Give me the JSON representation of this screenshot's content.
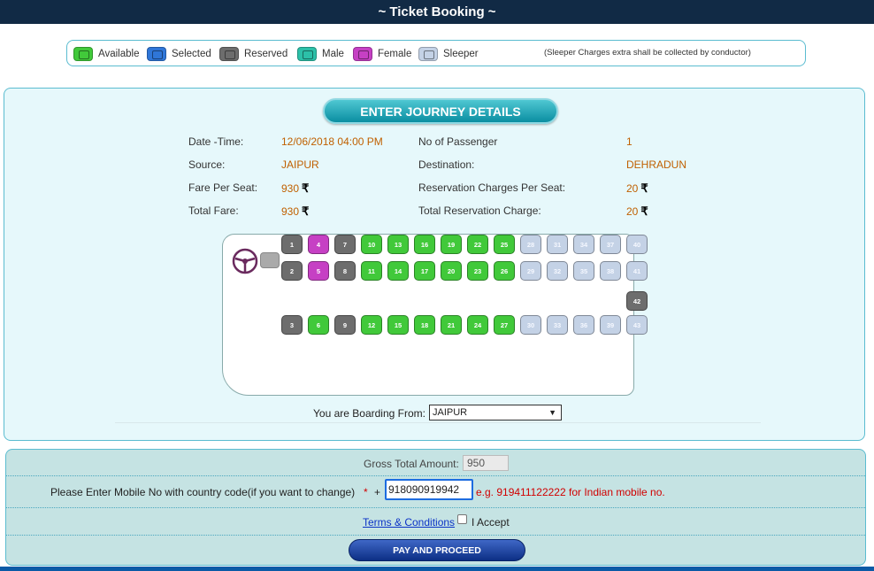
{
  "header": {
    "title": "~ Ticket Booking ~"
  },
  "legend": {
    "items": [
      {
        "label": "Available",
        "color": "#41c93a"
      },
      {
        "label": "Selected",
        "color": "#2f76d8"
      },
      {
        "label": "Reserved",
        "color": "#6d6d6d"
      },
      {
        "label": "Male",
        "color": "#2cc0a8"
      },
      {
        "label": "Female",
        "color": "#c640c4"
      },
      {
        "label": "Sleeper",
        "color": "#c4d2e6"
      }
    ],
    "note": "(Sleeper Charges extra shall be collected by conductor)"
  },
  "journey": {
    "title": "ENTER JOURNEY DETAILS",
    "rupee_symbol": "₹",
    "date_time_label": "Date -Time:",
    "date_time_value": "12/06/2018 04:00 PM",
    "passengers_label": "No of Passenger",
    "passengers_value": "1",
    "source_label": "Source:",
    "source_value": "JAIPUR",
    "destination_label": "Destination:",
    "destination_value": "DEHRADUN",
    "fare_label": "Fare Per Seat:",
    "fare_value": "930",
    "res_charge_label": "Reservation Charges Per Seat:",
    "res_charge_value": "20",
    "total_fare_label": "Total Fare:",
    "total_fare_value": "930",
    "total_res_label": "Total Reservation Charge:",
    "total_res_value": "20"
  },
  "seats": [
    {
      "number": "1",
      "status": "reserved"
    },
    {
      "number": "2",
      "status": "reserved"
    },
    {
      "number": "3",
      "status": "reserved"
    },
    {
      "number": "4",
      "status": "female"
    },
    {
      "number": "5",
      "status": "female"
    },
    {
      "number": "6",
      "status": "available"
    },
    {
      "number": "7",
      "status": "reserved"
    },
    {
      "number": "8",
      "status": "reserved"
    },
    {
      "number": "9",
      "status": "reserved"
    },
    {
      "number": "10",
      "status": "available"
    },
    {
      "number": "11",
      "status": "available"
    },
    {
      "number": "12",
      "status": "available"
    },
    {
      "number": "13",
      "status": "available"
    },
    {
      "number": "14",
      "status": "available"
    },
    {
      "number": "15",
      "status": "available"
    },
    {
      "number": "16",
      "status": "available"
    },
    {
      "number": "17",
      "status": "available"
    },
    {
      "number": "18",
      "status": "available"
    },
    {
      "number": "19",
      "status": "available"
    },
    {
      "number": "20",
      "status": "available"
    },
    {
      "number": "21",
      "status": "available"
    },
    {
      "number": "22",
      "status": "available"
    },
    {
      "number": "23",
      "status": "available"
    },
    {
      "number": "24",
      "status": "available"
    },
    {
      "number": "25",
      "status": "available"
    },
    {
      "number": "26",
      "status": "available"
    },
    {
      "number": "27",
      "status": "available"
    },
    {
      "number": "28",
      "status": "sleeper"
    },
    {
      "number": "29",
      "status": "sleeper"
    },
    {
      "number": "30",
      "status": "sleeper"
    },
    {
      "number": "31",
      "status": "sleeper"
    },
    {
      "number": "32",
      "status": "sleeper"
    },
    {
      "number": "33",
      "status": "sleeper"
    },
    {
      "number": "34",
      "status": "sleeper"
    },
    {
      "number": "35",
      "status": "sleeper"
    },
    {
      "number": "36",
      "status": "sleeper"
    },
    {
      "number": "37",
      "status": "sleeper"
    },
    {
      "number": "38",
      "status": "sleeper"
    },
    {
      "number": "39",
      "status": "sleeper"
    },
    {
      "number": "40",
      "status": "sleeper"
    },
    {
      "number": "41",
      "status": "sleeper"
    },
    {
      "number": "42",
      "status": "reserved"
    },
    {
      "number": "43",
      "status": "sleeper"
    }
  ],
  "boarding": {
    "label": "You are Boarding From:",
    "selected": "JAIPUR"
  },
  "payment": {
    "gross_label": "Gross Total Amount:",
    "gross_value": "950",
    "mobile_label": "Please Enter Mobile No with country code(if you want to change)",
    "required_mark": "*",
    "plus": "+",
    "mobile_value": "918090919942",
    "example": "e.g. 919411122222 for Indian mobile no.",
    "terms_label": "Terms & Conditions",
    "accept_label": "I Accept",
    "accept_checked": false,
    "pay_button": "PAY AND PROCEED"
  }
}
